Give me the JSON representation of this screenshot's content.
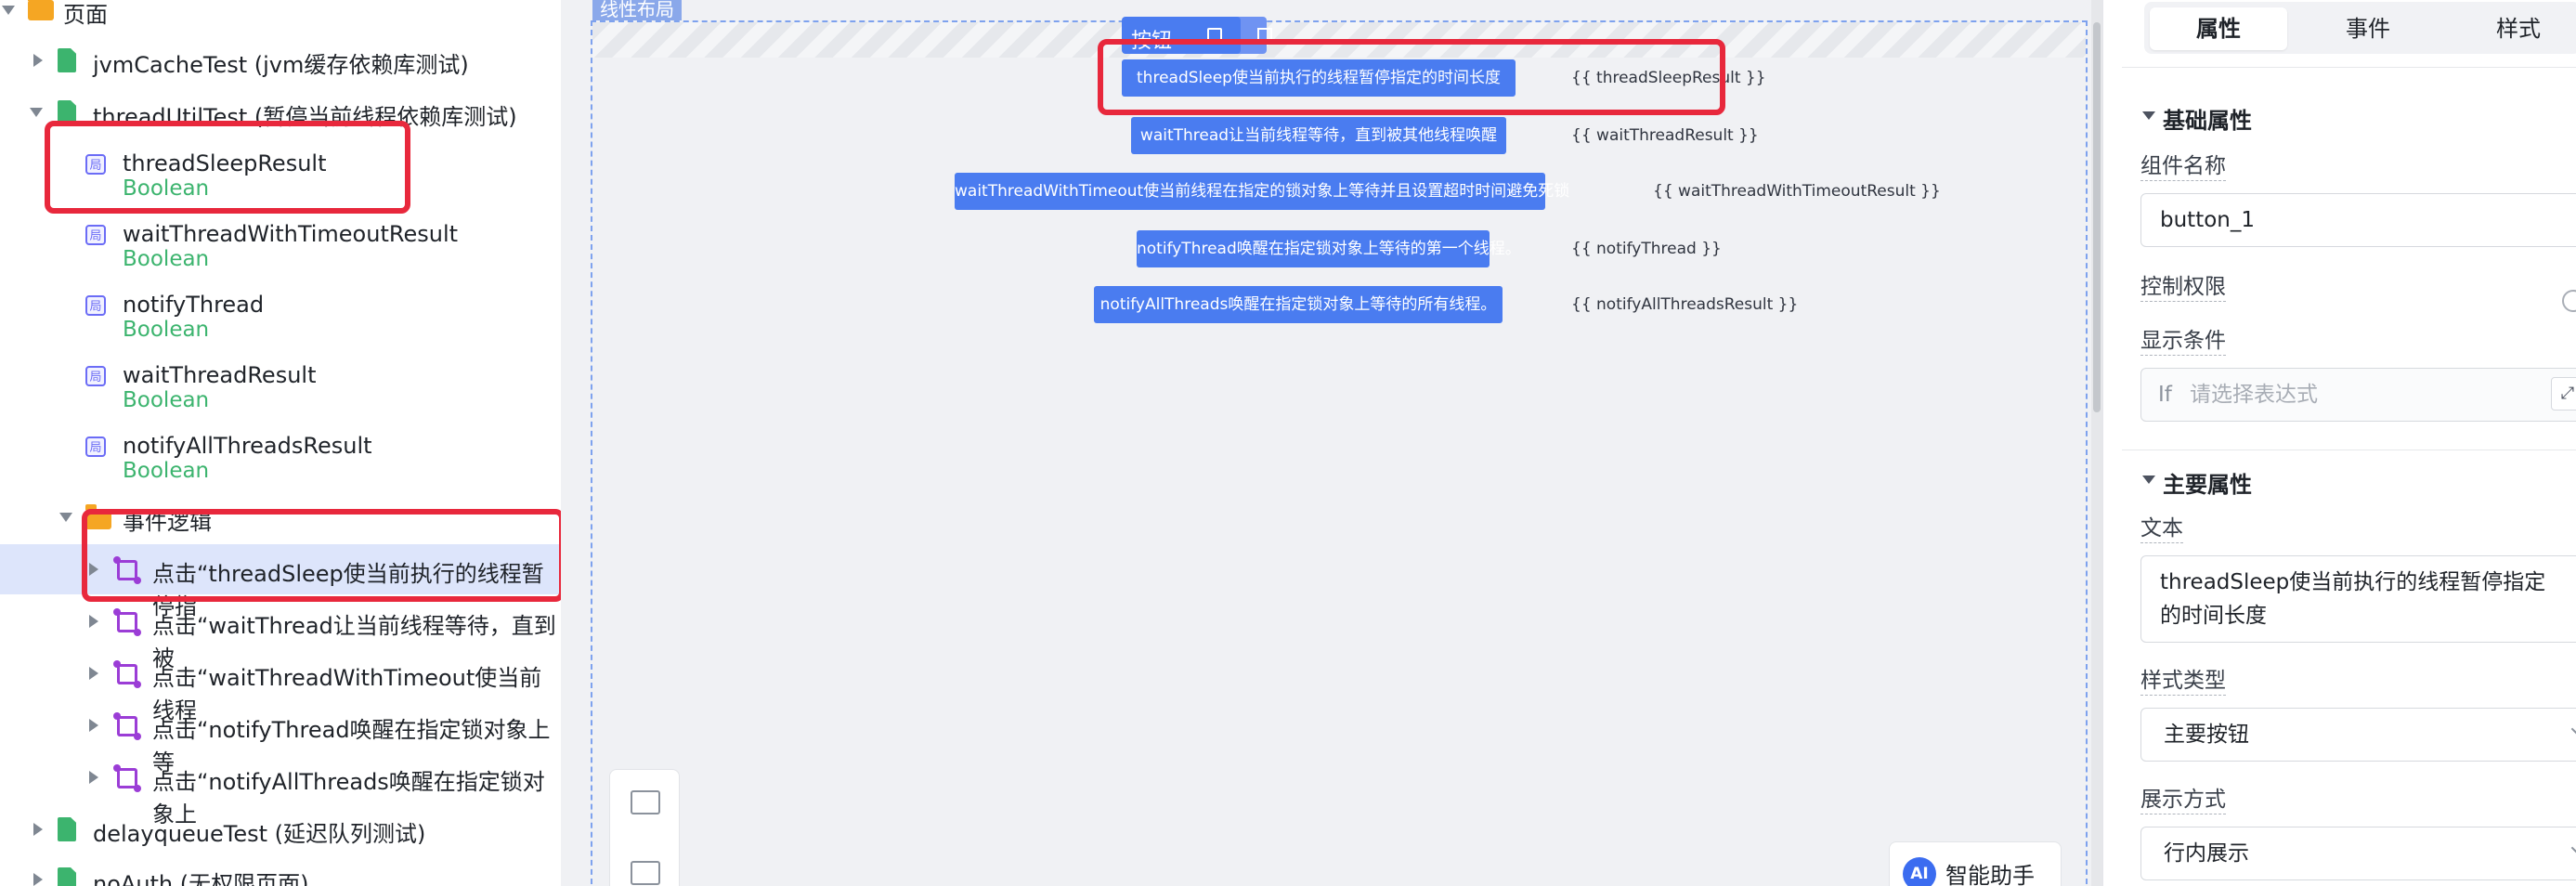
{
  "tree": {
    "root_label": "页面",
    "pages": [
      {
        "label": "jvmCacheTest (jvm缓存依赖库测试)"
      },
      {
        "label": "threadUtilTest (暂停当前线程依赖库测试)"
      }
    ],
    "variables": [
      {
        "badge": "局",
        "name": "threadSleepResult",
        "type": "Boolean"
      },
      {
        "badge": "局",
        "name": "waitThreadWithTimeoutResult",
        "type": "Boolean"
      },
      {
        "badge": "局",
        "name": "notifyThread",
        "type": "Boolean"
      },
      {
        "badge": "局",
        "name": "waitThreadResult",
        "type": "Boolean"
      },
      {
        "badge": "局",
        "name": "notifyAllThreadsResult",
        "type": "Boolean"
      }
    ],
    "event_folder": "事件逻辑",
    "events": [
      {
        "label": "点击“threadSleep使当前执行的线程暂停指"
      },
      {
        "label": "点击“waitThread让当前线程等待，直到被"
      },
      {
        "label": "点击“waitThreadWithTimeout使当前线程"
      },
      {
        "label": "点击“notifyThread唤醒在指定锁对象上等"
      },
      {
        "label": "点击“notifyAllThreads唤醒在指定锁对象上"
      }
    ],
    "more_pages": [
      {
        "label": "delayqueueTest (延迟队列测试)"
      },
      {
        "label": "noAuth (无权限页面)"
      }
    ]
  },
  "canvas": {
    "frame_label": "线性布局",
    "selected_tag": "按钮",
    "buttons": [
      {
        "text": "threadSleep使当前执行的线程暂停指定的时间长度",
        "binding": "{{ threadSleepResult }}"
      },
      {
        "text": "waitThread让当前线程等待，直到被其他线程唤醒",
        "binding": "{{ waitThreadResult }}"
      },
      {
        "text": "waitThreadWithTimeout使当前线程在指定的锁对象上等待并且设置超时时间避免死锁",
        "binding": "{{ waitThreadWithTimeoutResult }}"
      },
      {
        "text": "notifyThread唤醒在指定锁对象上等待的第一个线程。",
        "binding": "{{ notifyThread }}"
      },
      {
        "text": "notifyAllThreads唤醒在指定锁对象上等待的所有线程。",
        "binding": "{{ notifyAllThreadsResult }}"
      }
    ],
    "assistant": {
      "badge": "AI",
      "label": "智能助手"
    }
  },
  "inspector": {
    "tabs": [
      "属性",
      "事件",
      "样式"
    ],
    "active_tab": "属性",
    "basic_section": "基础属性",
    "component_name_label": "组件名称",
    "component_name_value": "button_1",
    "permission_label": "控制权限",
    "display_condition_label": "显示条件",
    "display_condition_prefix": "If",
    "display_condition_placeholder": "请选择表达式",
    "main_section": "主要属性",
    "text_label": "文本",
    "text_value": "threadSleep使当前执行的线程暂停指定的时间长度",
    "style_type_label": "样式类型",
    "style_type_value": "主要按钮",
    "display_mode_label": "展示方式",
    "display_mode_value": "行内展示"
  },
  "colors": {
    "primary": "#4a7cf0",
    "highlight": "#e8283c",
    "page_icon": "#3cb46e",
    "type_text": "#3cb46e",
    "variable_icon": "#6b6cf6",
    "event_icon": "#9b3dd6"
  }
}
